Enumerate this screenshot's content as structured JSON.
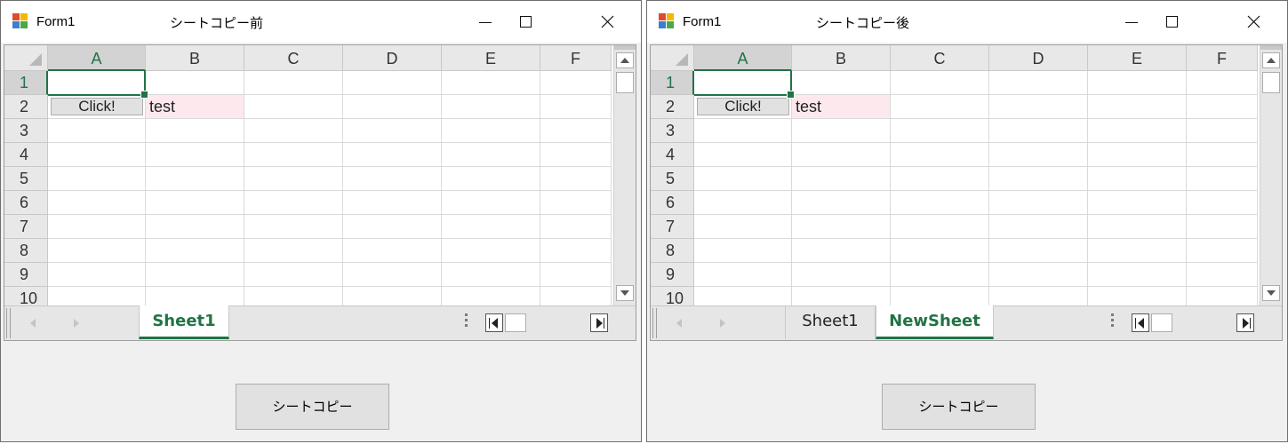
{
  "windows": [
    {
      "form_title": "Form1",
      "caption": "シートコピー前",
      "columns": [
        "A",
        "B",
        "C",
        "D",
        "E",
        "F"
      ],
      "rows": [
        "1",
        "2",
        "3",
        "4",
        "5",
        "6",
        "7",
        "8",
        "9",
        "10"
      ],
      "cell_button_label": "Click!",
      "cell_b2": "test",
      "tabs": [
        {
          "label": "Sheet1",
          "active": true
        }
      ],
      "copy_button_label": "シートコピー"
    },
    {
      "form_title": "Form1",
      "caption": "シートコピー後",
      "columns": [
        "A",
        "B",
        "C",
        "D",
        "E",
        "F"
      ],
      "rows": [
        "1",
        "2",
        "3",
        "4",
        "5",
        "6",
        "7",
        "8",
        "9",
        "10"
      ],
      "cell_button_label": "Click!",
      "cell_b2": "test",
      "tabs": [
        {
          "label": "Sheet1",
          "active": false
        },
        {
          "label": "NewSheet",
          "active": true
        }
      ],
      "copy_button_label": "シートコピー"
    }
  ],
  "colors": {
    "accent": "#217346",
    "highlight_cell": "#fde8ee"
  },
  "icons": [
    "app-icon",
    "minimize-icon",
    "maximize-icon",
    "close-icon",
    "scroll-up-icon",
    "scroll-down-icon",
    "tab-prev-icon",
    "tab-next-icon",
    "scroll-left-icon",
    "scroll-right-icon"
  ]
}
